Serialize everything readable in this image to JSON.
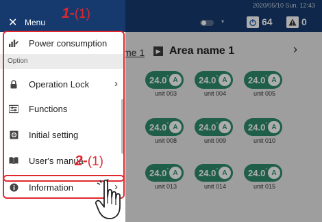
{
  "header": {
    "datetime": "2020/05/10 Sun. 12:43",
    "toggle_caret": "▾",
    "power_count": "64",
    "warning_count": "0"
  },
  "area": {
    "prev_label": "me 1",
    "name": "Area name 1"
  },
  "units": [
    {
      "name": "unit 003",
      "temp": "24.0",
      "mode": "A"
    },
    {
      "name": "unit 004",
      "temp": "24.0",
      "mode": "A"
    },
    {
      "name": "unit 005",
      "temp": "24.0",
      "mode": "A"
    },
    {
      "name": "unit 008",
      "temp": "24.0",
      "mode": "A"
    },
    {
      "name": "unit 009",
      "temp": "24.0",
      "mode": "A"
    },
    {
      "name": "unit 010",
      "temp": "24.0",
      "mode": "A"
    },
    {
      "name": "unit 013",
      "temp": "24.0",
      "mode": "A"
    },
    {
      "name": "unit 014",
      "temp": "24.0",
      "mode": "A"
    },
    {
      "name": "unit 015",
      "temp": "24.0",
      "mode": "A"
    }
  ],
  "menu": {
    "title": "Menu",
    "items": [
      {
        "label": "Power consumption",
        "icon": "bar-chart-icon"
      },
      {
        "label": "Operation Lock",
        "icon": "lock-icon"
      },
      {
        "label": "Functions",
        "icon": "functions-icon"
      },
      {
        "label": "Initial setting",
        "icon": "settings-icon"
      },
      {
        "label": "User's manua",
        "icon": "book-icon"
      },
      {
        "label": "Information",
        "icon": "info-icon"
      }
    ],
    "section_option": "Option"
  },
  "annotations": {
    "step1_num": "1",
    "step1_dash": "-",
    "step1_paren": "(1)",
    "step2_num": "2",
    "step2_dash": "-",
    "step2_paren": "(1)"
  },
  "colors": {
    "header_bg": "#163a6e",
    "unit_green": "#2e8d6e",
    "annotation_red": "#e0282e"
  }
}
